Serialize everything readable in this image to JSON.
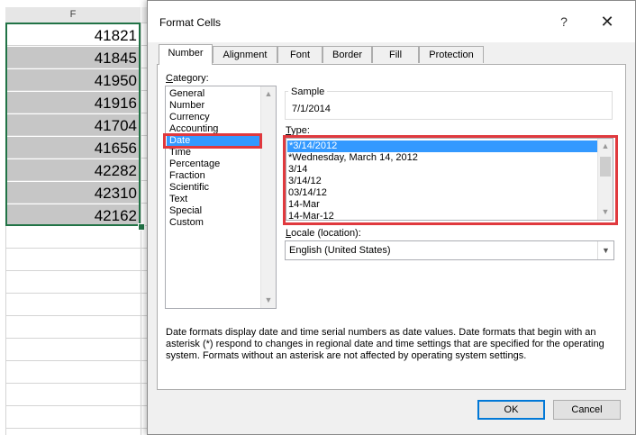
{
  "sheet": {
    "column_header": "F",
    "values": [
      "41821",
      "41845",
      "41950",
      "41916",
      "41704",
      "41656",
      "42282",
      "42310",
      "42162"
    ]
  },
  "dialog": {
    "title": "Format Cells",
    "help": "?",
    "close": "✕",
    "tabs": [
      "Number",
      "Alignment",
      "Font",
      "Border",
      "Fill",
      "Protection"
    ],
    "active_tab": "Number",
    "category_label_u": "C",
    "category_label_rest": "ategory:",
    "categories": [
      "General",
      "Number",
      "Currency",
      "Accounting",
      "Date",
      "Time",
      "Percentage",
      "Fraction",
      "Scientific",
      "Text",
      "Special",
      "Custom"
    ],
    "selected_category": "Date",
    "sample_label": "Sample",
    "sample_value": "7/1/2014",
    "type_label_u": "T",
    "type_label_rest": "ype:",
    "types": [
      "*3/14/2012",
      "*Wednesday, March 14, 2012",
      "3/14",
      "3/14/12",
      "03/14/12",
      "14-Mar",
      "14-Mar-12"
    ],
    "selected_type": "*3/14/2012",
    "locale_label_u": "L",
    "locale_label_rest": "ocale (location):",
    "locale_value": "English (United States)",
    "description": "Date formats display date and time serial numbers as date values.  Date formats that begin with an asterisk (*) respond to changes in regional date and time settings that are specified for the operating system. Formats without an asterisk are not affected by operating system settings.",
    "ok_label": "OK",
    "cancel_label": "Cancel"
  },
  "colors": {
    "selection_border": "#217346",
    "highlight": "#3399ff",
    "annotation_red": "#e0393e",
    "ok_focus": "#0078d7"
  }
}
